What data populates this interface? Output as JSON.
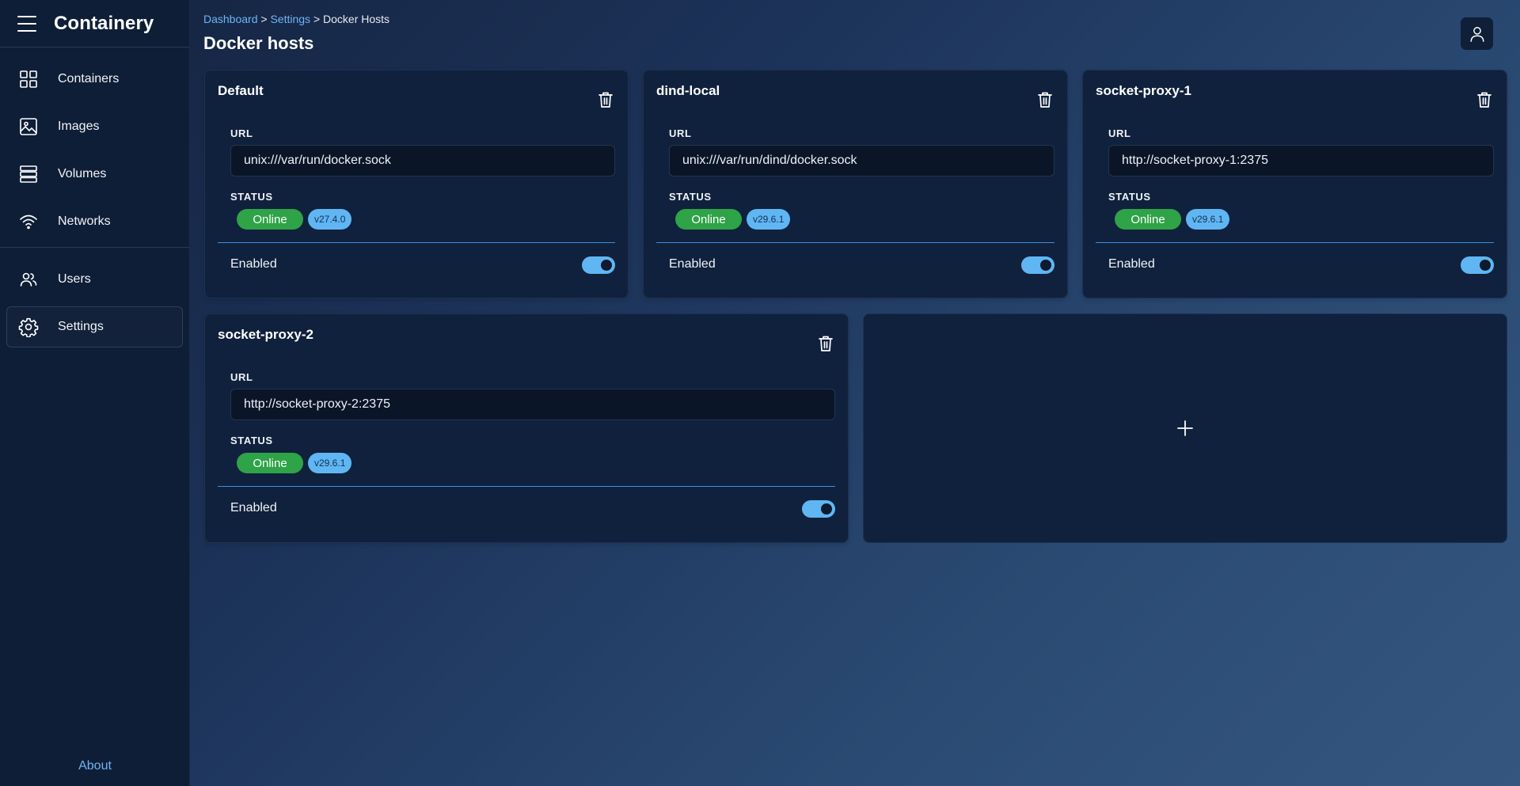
{
  "app": {
    "title": "Containery"
  },
  "sidebar": {
    "items": [
      {
        "label": "Containers",
        "icon": "grid-icon"
      },
      {
        "label": "Images",
        "icon": "image-icon"
      },
      {
        "label": "Volumes",
        "icon": "database-icon"
      },
      {
        "label": "Networks",
        "icon": "wifi-icon"
      },
      {
        "label": "Users",
        "icon": "users-icon"
      },
      {
        "label": "Settings",
        "icon": "gear-icon",
        "active": true
      }
    ],
    "about_label": "About"
  },
  "breadcrumb": {
    "dashboard": "Dashboard",
    "settings": "Settings",
    "current": "Docker Hosts",
    "separator": ">"
  },
  "page": {
    "title": "Docker hosts"
  },
  "labels": {
    "url": "URL",
    "status": "STATUS",
    "enabled": "Enabled"
  },
  "hosts": [
    {
      "name": "Default",
      "url": "unix:///var/run/docker.sock",
      "status": "Online",
      "version": "v27.4.0",
      "enabled": true
    },
    {
      "name": "dind-local",
      "url": "unix:///var/run/dind/docker.sock",
      "status": "Online",
      "version": "v29.6.1",
      "enabled": true
    },
    {
      "name": "socket-proxy-1",
      "url": "http://socket-proxy-1:2375",
      "status": "Online",
      "version": "v29.6.1",
      "enabled": true
    },
    {
      "name": "socket-proxy-2",
      "url": "http://socket-proxy-2:2375",
      "status": "Online",
      "version": "v29.6.1",
      "enabled": true
    }
  ],
  "add_host": {
    "icon": "plus-icon"
  },
  "colors": {
    "accent": "#5fb6f3",
    "online": "#2ea347",
    "link": "#6fb4f5",
    "card": "#10213d",
    "sidebar": "#0f1e37"
  }
}
